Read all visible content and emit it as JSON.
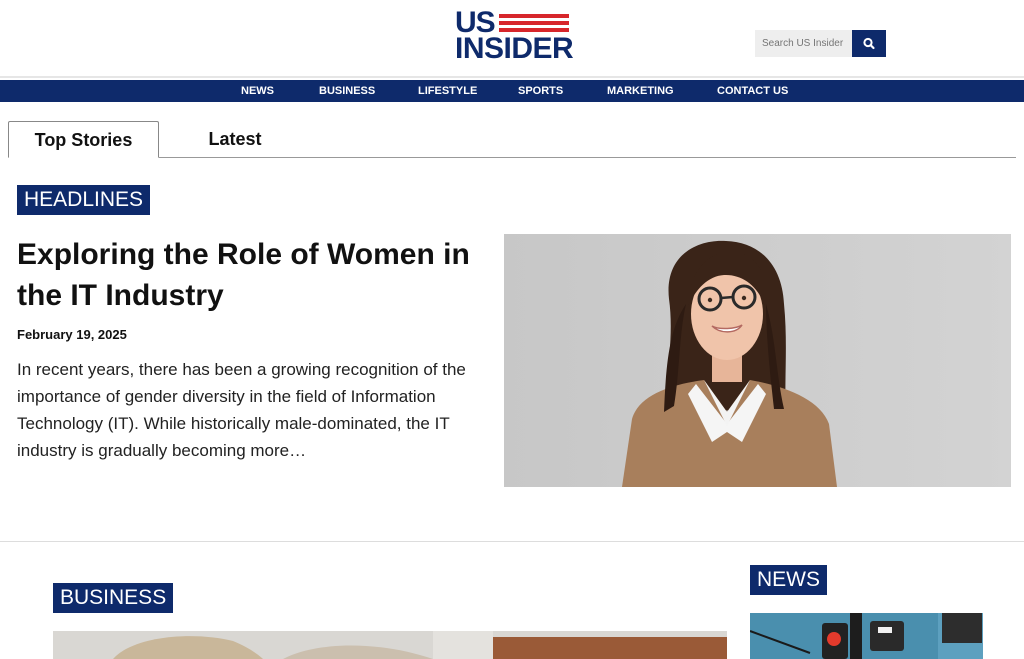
{
  "header": {
    "logo_line1": "US",
    "logo_line2": "INSIDER",
    "search_placeholder": "Search US Insider"
  },
  "nav": {
    "items": [
      {
        "label": "NEWS"
      },
      {
        "label": "BUSINESS"
      },
      {
        "label": "LIFESTYLE"
      },
      {
        "label": "SPORTS"
      },
      {
        "label": "MARKETING"
      },
      {
        "label": "CONTACT US"
      }
    ]
  },
  "tabs": [
    {
      "label": "Top Stories",
      "active": true
    },
    {
      "label": "Latest",
      "active": false
    }
  ],
  "headlines": {
    "section_label": "HEADLINES",
    "title": "Exploring the Role of Women in the IT Industry",
    "date": "February 19, 2025",
    "excerpt": "In recent years, there has been a growing recognition of the importance of gender diversity in the field of Information Technology (IT). While historically male-dominated, the IT industry is gradually becoming more…"
  },
  "business": {
    "section_label": "BUSINESS"
  },
  "news": {
    "section_label": "NEWS"
  },
  "colors": {
    "brand_navy": "#0e2a6b",
    "brand_red": "#d7262b"
  },
  "icons": {
    "search": "search-icon"
  }
}
